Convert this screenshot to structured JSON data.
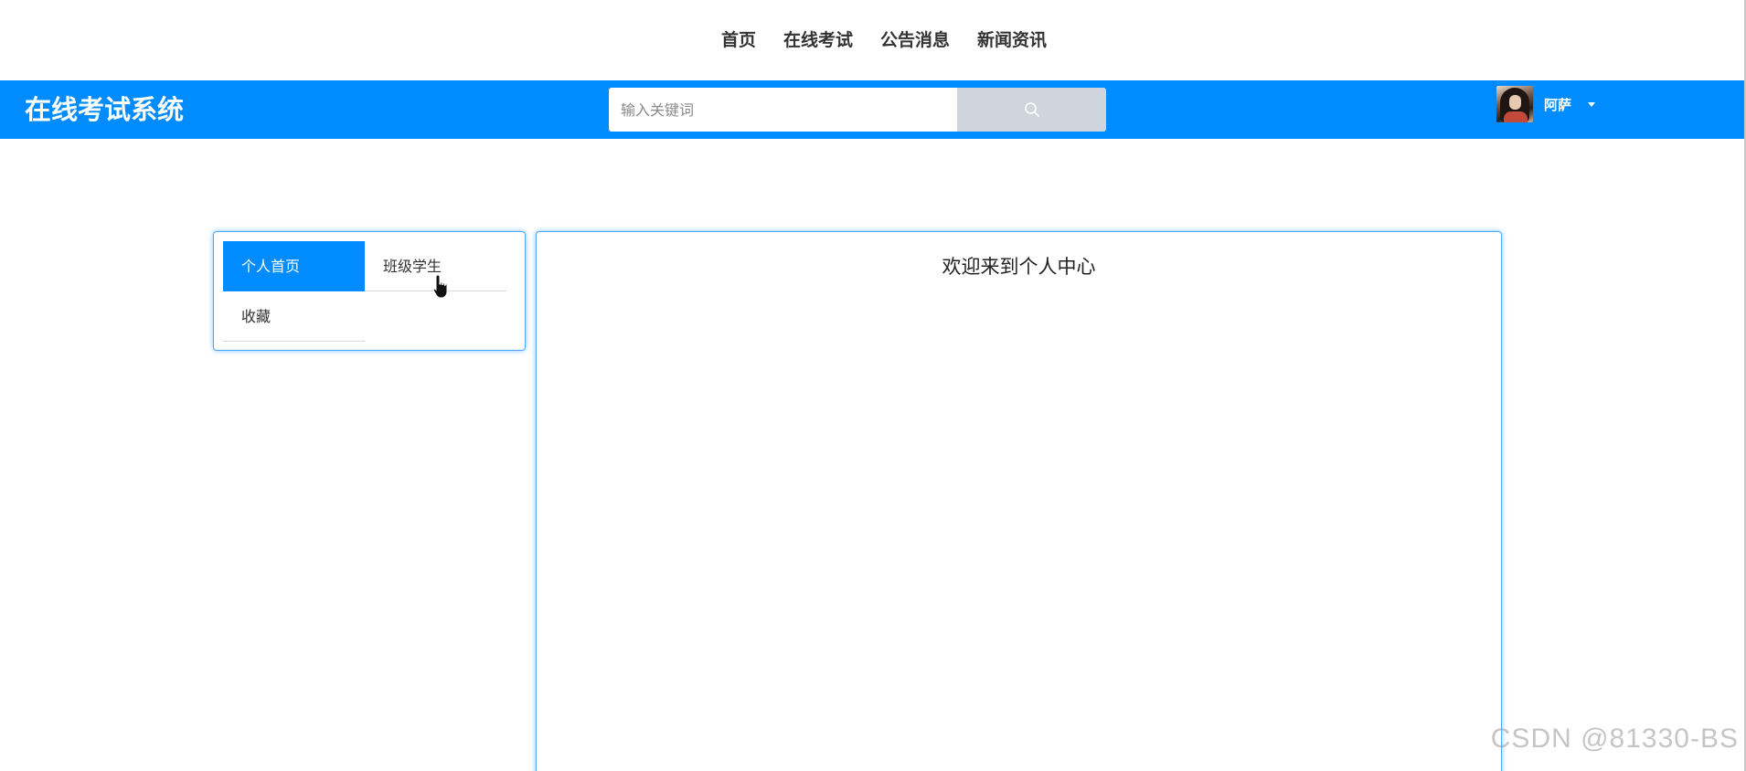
{
  "top_nav": {
    "links": [
      "首页",
      "在线考试",
      "公告消息",
      "新闻资讯"
    ]
  },
  "header": {
    "brand": "在线考试系统",
    "search": {
      "placeholder": "输入关键词",
      "value": ""
    },
    "user": {
      "name": "阿萨"
    }
  },
  "sidebar": {
    "items": [
      {
        "label": "个人首页",
        "active": true
      },
      {
        "label": "班级学生",
        "active": false
      },
      {
        "label": "收藏",
        "active": false
      }
    ]
  },
  "main": {
    "welcome": "欢迎来到个人中心"
  },
  "watermark": "CSDN @81330-BS",
  "colors": {
    "primary": "#008cff",
    "search_button": "#cfd5dc",
    "panel_border": "#4aa8ff"
  }
}
